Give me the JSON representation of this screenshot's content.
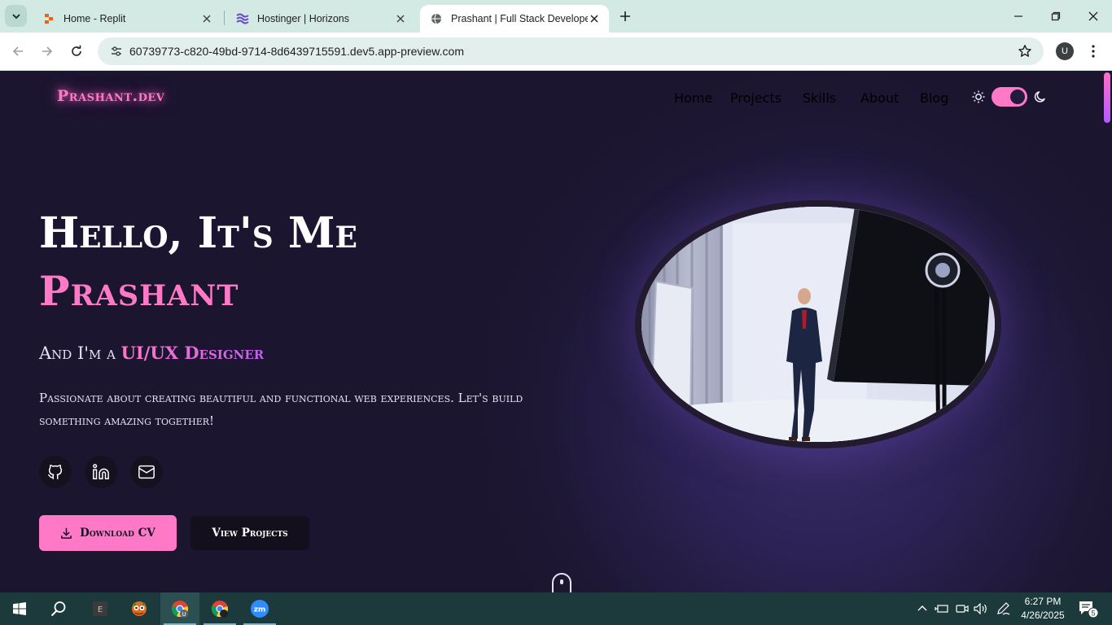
{
  "browser": {
    "tabs": [
      {
        "title": "Home - Replit",
        "favicon": "replit-icon",
        "active": false
      },
      {
        "title": "Hostinger | Horizons",
        "favicon": "hostinger-icon",
        "active": false
      },
      {
        "title": "Prashant | Full Stack Developer",
        "favicon": "globe-icon",
        "active": true
      }
    ],
    "url": "60739773-c820-49bd-9714-8d6439715591.dev5.app-preview.com",
    "profile_initial": "U"
  },
  "site": {
    "logo": "Prashant.dev",
    "nav": [
      "Home",
      "Projects",
      "Skills",
      "About",
      "Blog"
    ],
    "hero": {
      "greeting": "Hello, It's Me",
      "name": "Prashant",
      "subtitle_prefix": "And I'm a ",
      "role": "UI/UX Designer",
      "description": "Passionate about creating beautiful and functional web experiences. Let's build something amazing together!",
      "socials": [
        "github-icon",
        "linkedin-icon",
        "mail-icon"
      ],
      "download_cv": "Download CV",
      "view_projects": "View Projects"
    },
    "accent_color": "#ff79c6"
  },
  "taskbar": {
    "time": "6:27 PM",
    "date": "4/26/2025",
    "notification_count": "5"
  }
}
